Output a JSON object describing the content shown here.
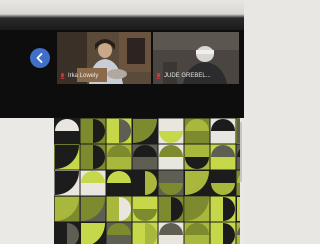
{
  "meeting": {
    "participants": [
      {
        "name": "Irka Lowely"
      },
      {
        "name": "JUDE GREBEL..."
      }
    ]
  },
  "icons": {
    "back": "back-arrow-icon",
    "mic": "mic-muted-icon"
  },
  "colors": {
    "accent": "#3f6fc9",
    "mic_muted": "#d13b3b",
    "pattern_lime": "#c6d84a",
    "pattern_olive": "#7d8a2d",
    "pattern_dark": "#1c1c1c",
    "pattern_light": "#e8e6df"
  }
}
